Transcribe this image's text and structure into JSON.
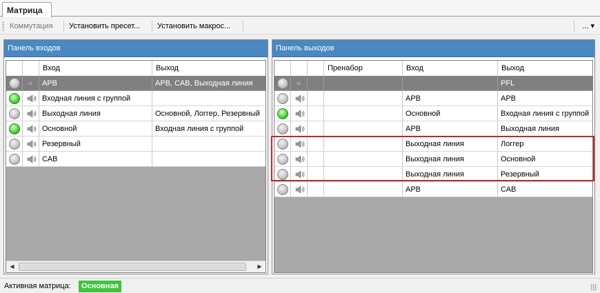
{
  "tab": {
    "label": "Матрица"
  },
  "toolbar": {
    "commutation_label": "Коммутация",
    "set_preset_label": "Установить пресет...",
    "set_macro_label": "Установить макрос...",
    "more_label": "... ▾"
  },
  "inputs_panel": {
    "title": "Панель входов",
    "columns": {
      "input": "Вход",
      "output": "Выход"
    },
    "rows": [
      {
        "status": "grey",
        "input": "АРВ",
        "output": "АРВ, САВ, Выходная линия",
        "selected": true
      },
      {
        "status": "green",
        "input": "Входная линия с группой",
        "output": ""
      },
      {
        "status": "grey",
        "input": "Выходная линия",
        "output": "Основной, Логгер, Резервный"
      },
      {
        "status": "green",
        "input": "Основной",
        "output": "Входная линия с группой"
      },
      {
        "status": "grey",
        "input": "Резервный",
        "output": ""
      },
      {
        "status": "grey",
        "input": "САВ",
        "output": ""
      }
    ]
  },
  "outputs_panel": {
    "title": "Панель выходов",
    "columns": {
      "preset": "Пренабор",
      "input": "Вход",
      "output": "Выход"
    },
    "rows": [
      {
        "status": "grey",
        "preset": "",
        "input": "",
        "output": "PFL",
        "selected": true
      },
      {
        "status": "grey",
        "preset": "",
        "input": "АРВ",
        "output": "АРВ"
      },
      {
        "status": "green",
        "preset": "",
        "input": "Основной",
        "output": "Входная линия с группой"
      },
      {
        "status": "grey",
        "preset": "",
        "input": "АРВ",
        "output": "Выходная линия"
      },
      {
        "status": "grey",
        "preset": "",
        "input": "Выходная линия",
        "output": "Логгер"
      },
      {
        "status": "grey",
        "preset": "",
        "input": "Выходная линия",
        "output": "Основной"
      },
      {
        "status": "grey",
        "preset": "",
        "input": "Выходная линия",
        "output": "Резервный"
      },
      {
        "status": "grey",
        "preset": "",
        "input": "АРВ",
        "output": "САВ"
      }
    ]
  },
  "status": {
    "active_matrix_label": "Активная матрица:",
    "active_matrix_value": "Основная"
  },
  "colors": {
    "panel_header": "#4a88c0",
    "selected_row": "#808080",
    "status_green": "#3ec43a",
    "highlight_box": "#c0262c"
  }
}
